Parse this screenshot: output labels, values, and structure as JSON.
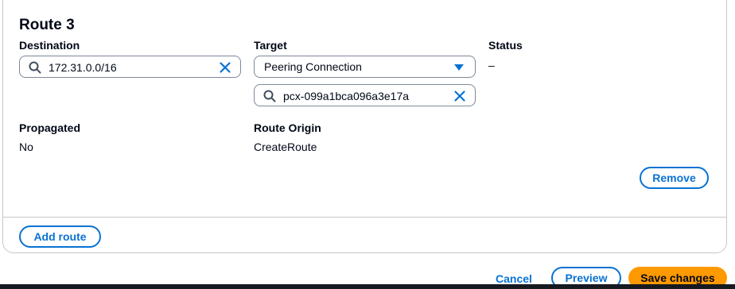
{
  "route": {
    "title": "Route 3",
    "destination": {
      "label": "Destination",
      "value": "172.31.0.0/16"
    },
    "target": {
      "label": "Target",
      "selected": "Peering Connection",
      "search_value": "pcx-099a1bca096a3e17a"
    },
    "status": {
      "label": "Status",
      "value": "–"
    },
    "propagated": {
      "label": "Propagated",
      "value": "No"
    },
    "origin": {
      "label": "Route Origin",
      "value": "CreateRoute"
    },
    "remove_label": "Remove"
  },
  "add_route_label": "Add route",
  "footer": {
    "cancel_label": "Cancel",
    "preview_label": "Preview",
    "save_label": "Save changes"
  },
  "colors": {
    "accent": "#0972d3",
    "primary": "#ff9900",
    "border": "#7d8998"
  },
  "icons": {
    "search": "search-icon",
    "clear": "close-icon",
    "caret": "caret-down-icon"
  }
}
